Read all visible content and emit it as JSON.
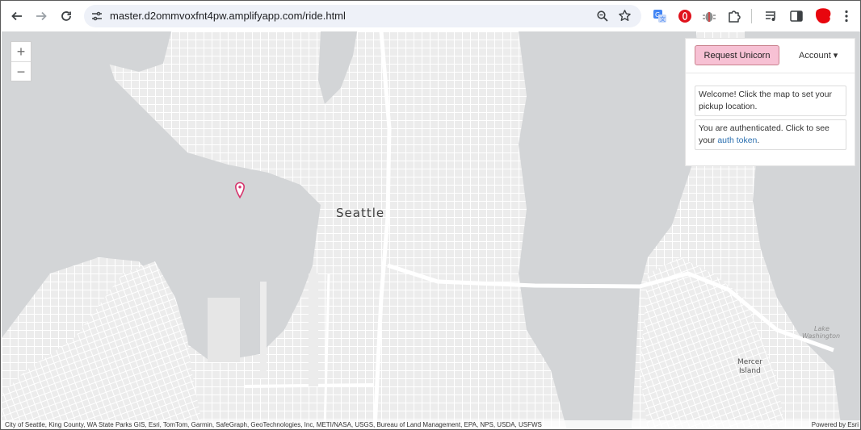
{
  "browser": {
    "url": "master.d2ommvoxfnt4pw.amplifyapp.com/ride.html"
  },
  "map": {
    "labels": {
      "seattle": "Seattle",
      "lake_washington_line1": "Lake",
      "lake_washington_line2": "Washington",
      "mercer_line1": "Mercer",
      "mercer_line2": "Island"
    },
    "attribution": "City of Seattle, King County, WA State Parks GIS, Esri, TomTom, Garmin, SafeGraph, GeoTechnologies, Inc, METI/NASA, USGS, Bureau of Land Management, EPA, NPS, USDA, USFWS",
    "powered_by": "Powered by Esri",
    "zoom_in": "+",
    "zoom_out": "−"
  },
  "panel": {
    "request_button": "Request Unicorn",
    "account_menu": "Account ▾",
    "messages": {
      "welcome": "Welcome! Click the map to set your pickup location.",
      "auth_prefix": "You are authenticated. Click to see your ",
      "auth_link": "auth token",
      "auth_suffix": "."
    }
  },
  "colors": {
    "water": "#d3d5d7",
    "land": "#eeeeee",
    "button_pink": "#f7c1d4",
    "pin": "#d6336c",
    "link": "#2a6fb0"
  }
}
